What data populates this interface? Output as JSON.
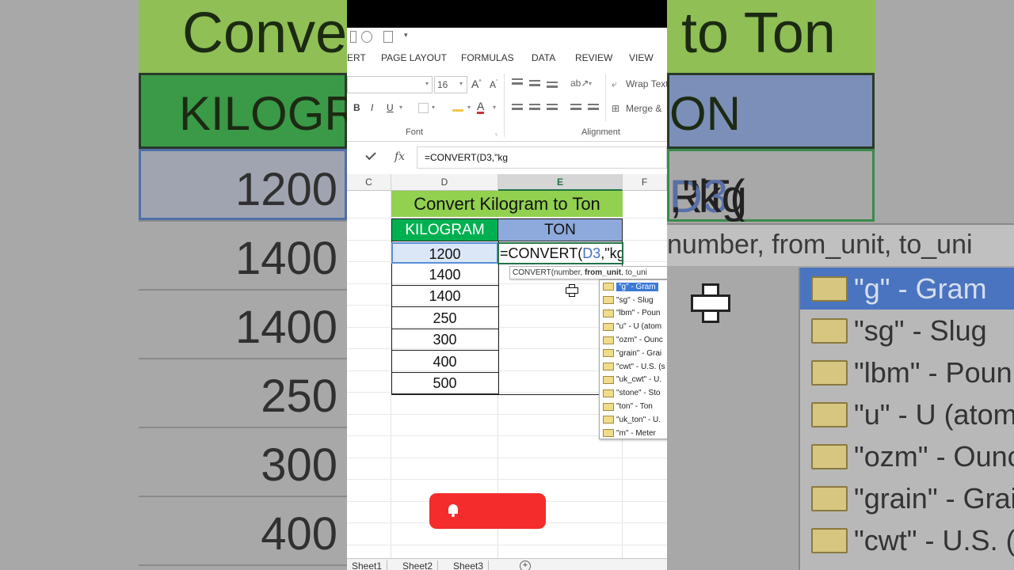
{
  "background": {
    "title_left": "Conve",
    "title_right": "to Ton",
    "header_left": "KILOGR",
    "header_right": "ON",
    "values": [
      "1200",
      "1400",
      "1400",
      "250",
      "300",
      "400"
    ],
    "formula": {
      "pre": "RT(",
      "ref": "D3",
      "post": ",\"kg"
    },
    "tooltip": "number, from_unit, to_uni",
    "list": [
      {
        "label": "\"g\" - Gram",
        "selected": true
      },
      {
        "label": "\"sg\" - Slug",
        "selected": false
      },
      {
        "label": "\"lbm\" - Poun",
        "selected": false
      },
      {
        "label": "\"u\" - U (atom",
        "selected": false
      },
      {
        "label": "\"ozm\" - Ounc",
        "selected": false
      },
      {
        "label": "\"grain\" - Grai",
        "selected": false
      },
      {
        "label": "\"cwt\" - U.S. (s",
        "selected": false
      }
    ]
  },
  "ribbon": {
    "tabs": [
      "ERT",
      "PAGE LAYOUT",
      "FORMULAS",
      "DATA",
      "REVIEW",
      "VIEW"
    ],
    "font_size": "16",
    "bold": "B",
    "italic": "I",
    "underline": "U",
    "wrap_text": "Wrap Text",
    "merge": "Merge &",
    "group_font": "Font",
    "group_alignment": "Alignment"
  },
  "formula_bar": {
    "fx": "fx",
    "content": "=CONVERT(D3,\"kg"
  },
  "columns": [
    "C",
    "D",
    "E",
    "F"
  ],
  "active_column": "E",
  "sheet": {
    "title": "Convert Kilogram to Ton",
    "header_kg": "KILOGRAM",
    "header_ton": "TON",
    "kilograms": [
      "1200",
      "1400",
      "1400",
      "250",
      "300",
      "400",
      "500"
    ],
    "editing": {
      "pre": "=CONVERT(",
      "ref": "D3",
      "post": ",\"kg"
    },
    "tooltip": {
      "fn": "CONVERT(number, ",
      "bold": "from_unit",
      "rest": ", to_uni"
    }
  },
  "autocomplete": [
    {
      "label": "\"g\" - Gram",
      "selected": true
    },
    {
      "label": "\"sg\" - Slug",
      "selected": false
    },
    {
      "label": "\"lbm\" - Poun",
      "selected": false
    },
    {
      "label": "\"u\" - U (atom",
      "selected": false
    },
    {
      "label": "\"ozm\" - Ounc",
      "selected": false
    },
    {
      "label": "\"grain\" - Grai",
      "selected": false
    },
    {
      "label": "\"cwt\" - U.S. (s",
      "selected": false
    },
    {
      "label": "\"uk_cwt\" - U.",
      "selected": false
    },
    {
      "label": "\"stone\" - Sto",
      "selected": false
    },
    {
      "label": "\"ton\" - Ton",
      "selected": false
    },
    {
      "label": "\"uk_ton\" - U.",
      "selected": false
    },
    {
      "label": "\"m\" - Meter",
      "selected": false
    }
  ],
  "sheet_tabs": [
    "Sheet1",
    "Sheet2",
    "Sheet3"
  ],
  "colors": {
    "title_fill": "#92d050",
    "kg_header": "#00b050",
    "ton_header": "#8ea9db",
    "subscribe": "#f42c2c",
    "excel_green": "#217346"
  }
}
